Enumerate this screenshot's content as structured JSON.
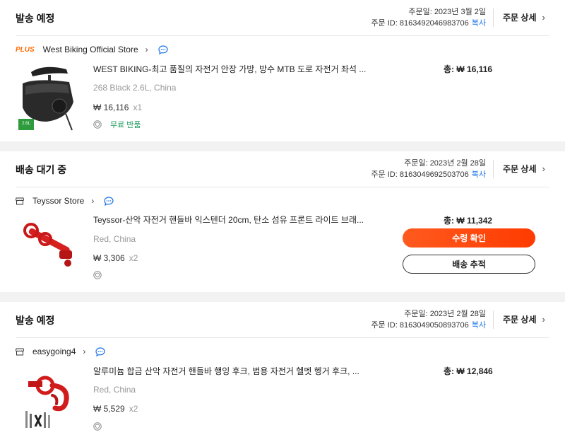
{
  "orders": [
    {
      "status": "발송 예정",
      "order_date": "주문일: 2023년 3월 2일",
      "order_id": "주문 ID: 8163492046983706",
      "copy_label": "복사",
      "detail_label": "주문 상세",
      "store_badge": "PLUS",
      "store_name": "West Biking Official Store",
      "item_title": "WEST BIKING-최고 품질의 자전거 안장 가방, 방수 MTB 도로 자전거 좌석 ...",
      "variant": "268 Black 2.6L, China",
      "price": "₩ 16,116",
      "qty": "x1",
      "free_return": "무료 반품",
      "total": "총: ₩ 16,116",
      "thumb_label": "2.6L"
    },
    {
      "status": "배송 대기 중",
      "order_date": "주문일: 2023년 2월 28일",
      "order_id": "주문 ID: 8163049692503706",
      "copy_label": "복사",
      "detail_label": "주문 상세",
      "store_name": "Teyssor Store",
      "item_title": "Teyssor-산악 자전거 핸들바 익스텐더 20cm, 탄소 섬유 프론트 라이트 브래...",
      "variant": "Red, China",
      "price": "₩ 3,306",
      "qty": "x2",
      "total": "총: ₩ 11,342",
      "primary_button": "수령 확인",
      "secondary_button": "배송 추적"
    },
    {
      "status": "발송 예정",
      "order_date": "주문일: 2023년 2월 28일",
      "order_id": "주문 ID: 8163049050893706",
      "copy_label": "복사",
      "detail_label": "주문 상세",
      "store_name": "easygoing4",
      "item_title": "알루미늄 합금 산악 자전거 핸들바 행잉 후크, 범용 자전거 헬멧 헹거 후크, ...",
      "variant": "Red, China",
      "price": "₩ 5,529",
      "qty": "x2",
      "total": "총: ₩ 12,846"
    }
  ],
  "icons": {
    "chevron": "chevron-right-icon",
    "message": "message-icon",
    "shop": "shop-icon",
    "shield": "shield-icon"
  },
  "colors": {
    "accent": "#ff4d12",
    "link": "#1a73e8",
    "free_return": "#1b9a5a",
    "plus_badge": "#ff6a00"
  }
}
